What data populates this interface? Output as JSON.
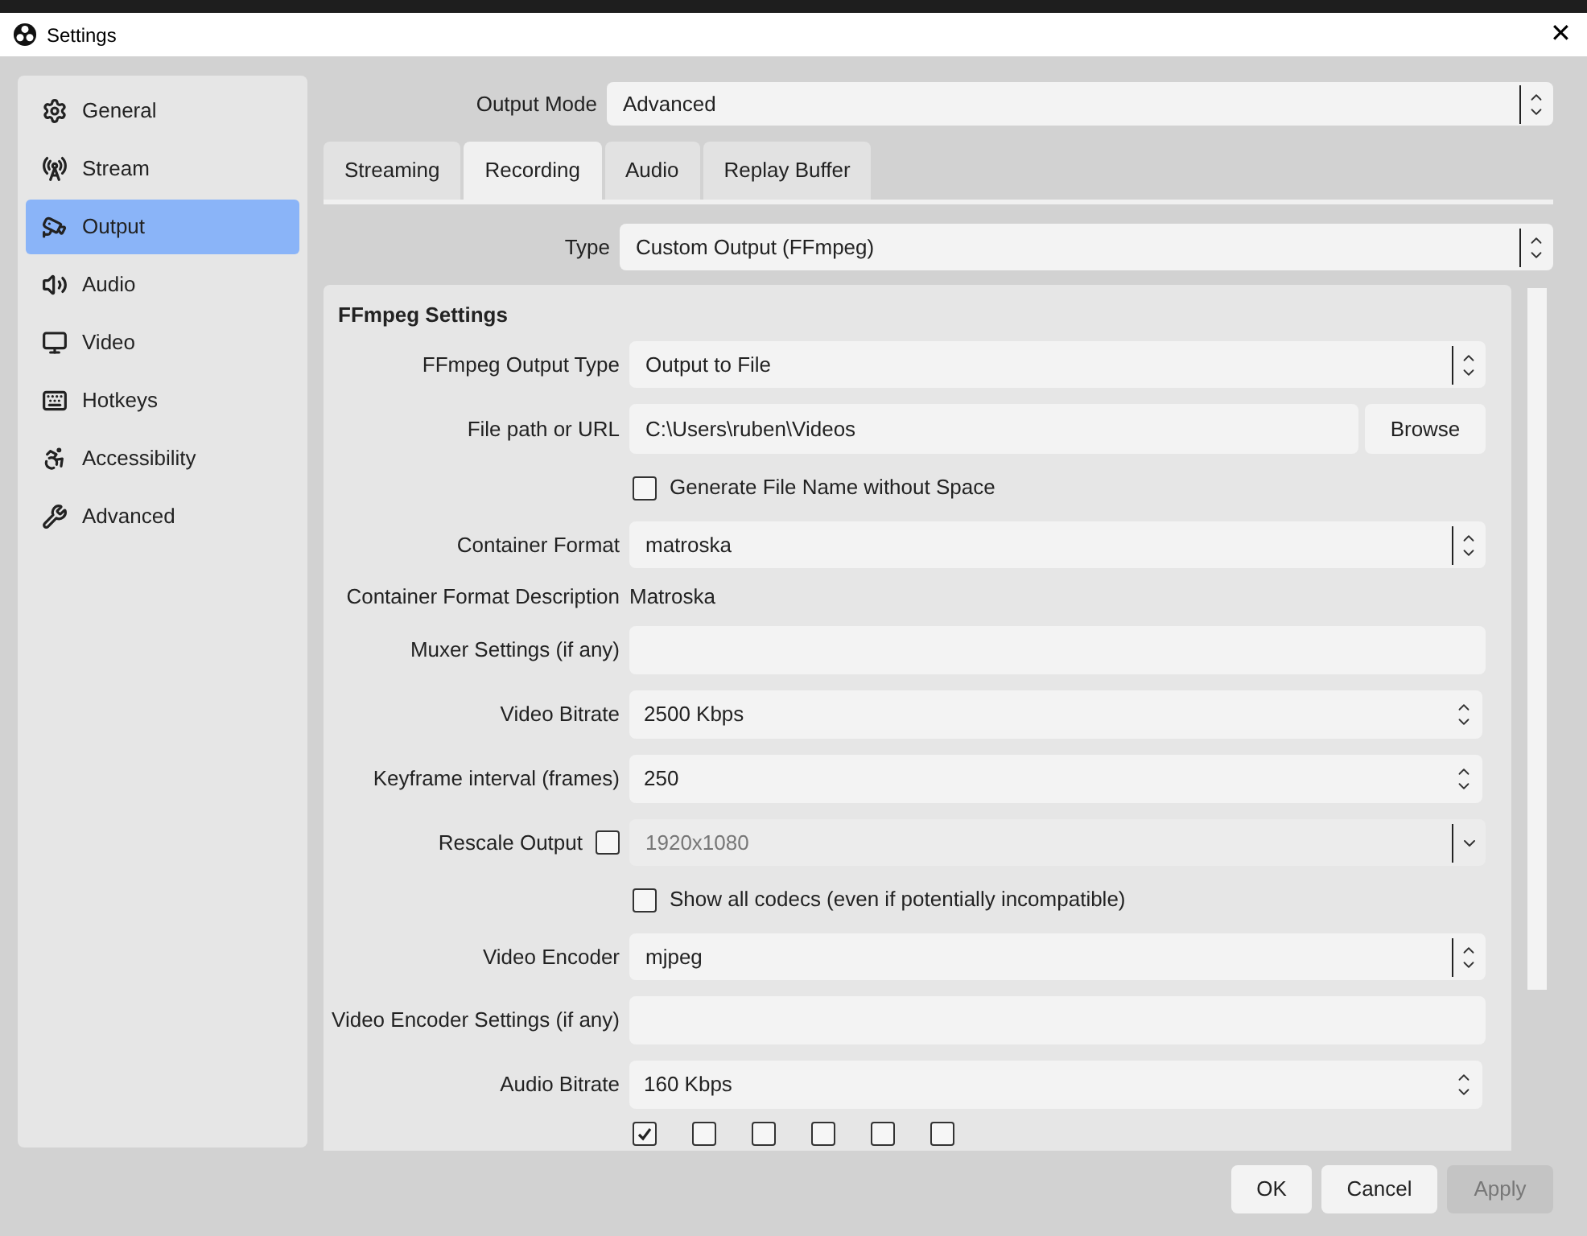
{
  "window": {
    "title": "Settings",
    "close": "✕"
  },
  "sidebar": {
    "items": [
      {
        "label": "General",
        "selected": false
      },
      {
        "label": "Stream",
        "selected": false
      },
      {
        "label": "Output",
        "selected": true
      },
      {
        "label": "Audio",
        "selected": false
      },
      {
        "label": "Video",
        "selected": false
      },
      {
        "label": "Hotkeys",
        "selected": false
      },
      {
        "label": "Accessibility",
        "selected": false
      },
      {
        "label": "Advanced",
        "selected": false
      }
    ]
  },
  "output_mode": {
    "label": "Output Mode",
    "value": "Advanced"
  },
  "tabs": [
    {
      "label": "Streaming",
      "selected": false
    },
    {
      "label": "Recording",
      "selected": true
    },
    {
      "label": "Audio",
      "selected": false
    },
    {
      "label": "Replay Buffer",
      "selected": false
    }
  ],
  "type": {
    "label": "Type",
    "value": "Custom Output (FFmpeg)"
  },
  "section": {
    "title": "FFmpeg Settings",
    "rows": [
      {
        "kind": "select",
        "label": "FFmpeg Output Type",
        "value": "Output to File"
      },
      {
        "kind": "path",
        "label": "File path or URL",
        "value": "C:\\Users\\ruben\\Videos",
        "button": "Browse"
      },
      {
        "kind": "checkbox",
        "label": "Generate File Name without Space",
        "checked": false
      },
      {
        "kind": "select",
        "label": "Container Format",
        "value": "matroska"
      },
      {
        "kind": "info",
        "label": "Container Format Description",
        "value": "Matroska"
      },
      {
        "kind": "text",
        "label": "Muxer Settings (if any)"
      },
      {
        "kind": "spin",
        "label": "Video Bitrate",
        "value": "2500 Kbps"
      },
      {
        "kind": "spin",
        "label": "Keyframe interval (frames)",
        "value": "250"
      },
      {
        "kind": "rescale",
        "label": "Rescale Output",
        "checked": false,
        "value": "1920x1080",
        "disabled": true
      },
      {
        "kind": "checkbox",
        "label": "Show all codecs (even if potentially incompatible)",
        "checked": false
      },
      {
        "kind": "select",
        "label": "Video Encoder",
        "value": "mjpeg"
      },
      {
        "kind": "text",
        "label": "Video Encoder Settings (if any)"
      },
      {
        "kind": "spin",
        "label": "Audio Bitrate",
        "value": "160 Kbps"
      },
      {
        "kind": "tracks",
        "tracks": [
          {
            "checked": true
          },
          {
            "checked": false
          },
          {
            "checked": false
          },
          {
            "checked": false
          },
          {
            "checked": false
          },
          {
            "checked": false
          }
        ]
      }
    ]
  },
  "buttons": [
    {
      "label": "OK",
      "disabled": false
    },
    {
      "label": "Cancel",
      "disabled": false
    },
    {
      "label": "Apply",
      "disabled": true
    }
  ]
}
